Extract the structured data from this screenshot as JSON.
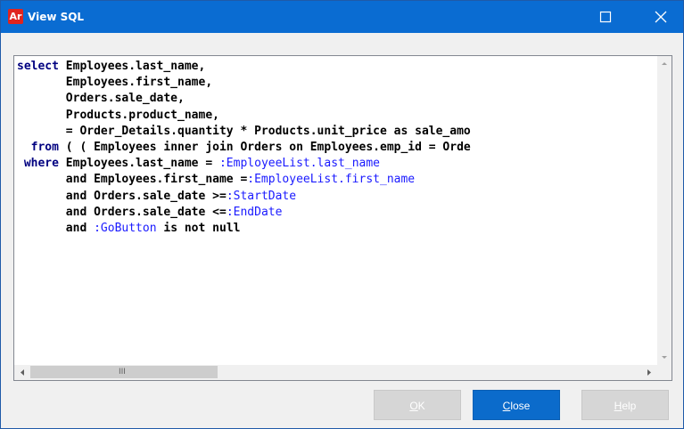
{
  "window": {
    "title": "View SQL",
    "app_icon_text": "Ar",
    "accent_color": "#0a6cd2"
  },
  "titlebar_controls": {
    "maximize_icon": "maximize-icon",
    "close_icon": "close-icon"
  },
  "sql_lines": [
    [
      {
        "t": "select",
        "c": "kw"
      },
      {
        "t": " Employees.last_name,",
        "c": "tx"
      }
    ],
    [
      {
        "t": "       Employees.first_name,",
        "c": "tx"
      }
    ],
    [
      {
        "t": "       Orders.sale_date,",
        "c": "tx"
      }
    ],
    [
      {
        "t": "       Products.product_name,",
        "c": "tx"
      }
    ],
    [
      {
        "t": "       = Order_Details.quantity * Products.unit_price as sale_amo",
        "c": "tx"
      }
    ],
    [
      {
        "t": "  from",
        "c": "kw"
      },
      {
        "t": " ( ( Employees inner join Orders on Employees.emp_id = Orde",
        "c": "tx"
      }
    ],
    [
      {
        "t": " where",
        "c": "kw"
      },
      {
        "t": " Employees.last_name = ",
        "c": "tx"
      },
      {
        "t": ":EmployeeList.last_name",
        "c": "param"
      }
    ],
    [
      {
        "t": "       and Employees.first_name =",
        "c": "tx"
      },
      {
        "t": ":EmployeeList.first_name",
        "c": "param"
      }
    ],
    [
      {
        "t": "       and Orders.sale_date >=",
        "c": "tx"
      },
      {
        "t": ":StartDate",
        "c": "param"
      }
    ],
    [
      {
        "t": "       and Orders.sale_date <=",
        "c": "tx"
      },
      {
        "t": ":EndDate",
        "c": "param"
      }
    ],
    [
      {
        "t": "       and ",
        "c": "tx"
      },
      {
        "t": ":GoButton",
        "c": "param"
      },
      {
        "t": " is not null",
        "c": "tx"
      }
    ]
  ],
  "scrollbar": {
    "thumb_grip": "III"
  },
  "buttons": {
    "ok": {
      "mnemonic": "O",
      "rest": "K"
    },
    "close": {
      "mnemonic": "C",
      "rest": "lose"
    },
    "help": {
      "mnemonic": "H",
      "rest": "elp"
    }
  }
}
